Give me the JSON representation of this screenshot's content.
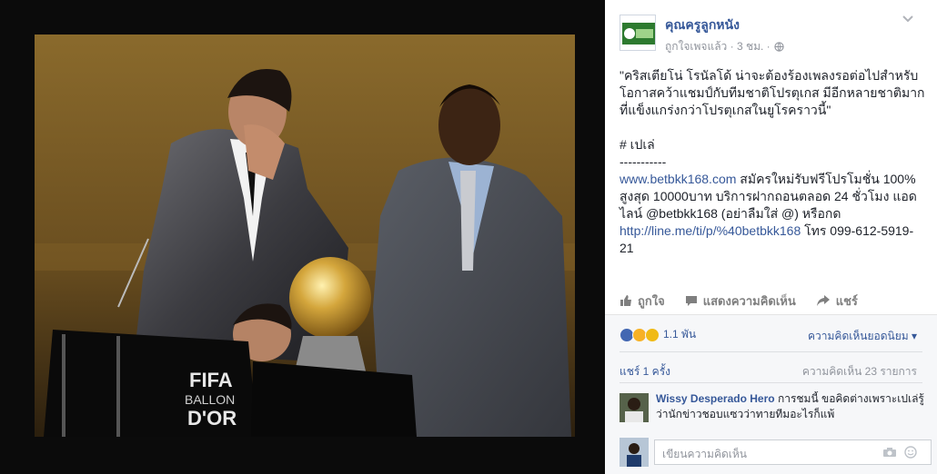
{
  "post": {
    "page_name": "คุณครูลูกหนัง",
    "subtitle": "ถูกใจเพจแล้ว · 3 ชม. ·",
    "caption": "\"คริสเตียโน่ โรนัลโด้ น่าจะต้องร้องเพลงรอต่อไปสำหรับโอกาสคว้าแชมป์กับทีมชาติโปรตุเกส มีอีกหลายชาติมากที่แข็งแกร่งกว่าโปรตุเกสในยูโรคราวนี้\"",
    "tag": "# เปเล่",
    "separator": "-----------",
    "promo_link": "www.betbkk168.com",
    "promo_text": " สมัครใหม่รับฟรีโปรโมชั่น 100% สูงสุด 10000บาท บริการฝากถอนตลอด 24 ชั่วโมง แอดไลน์ @betbkk168 (อย่าลืมใส่ @) หรือกด ",
    "line_link": "http://line.me/ti/p/%40betbkk168",
    "phone_text": " โทร 099-612-5919-21",
    "photo_text": {
      "fifa": "FIFA",
      "ballon": "BALLON",
      "dor": "D'OR"
    }
  },
  "actions": {
    "like": "ถูกใจ",
    "comment": "แสดงความคิดเห็น",
    "share": "แชร์"
  },
  "engagement": {
    "reactions_count": "1.1 พัน",
    "sort_label": "ความคิดเห็นยอดนิยม",
    "shares": "แชร์ 1 ครั้ง",
    "comments": "ความคิดเห็น 23 รายการ"
  },
  "comment": {
    "author": "Wissy Desperado Hero",
    "text": " การชมนี้ ขอคิดต่างเพราะเปเล่รู้ว่านักข่าวชอบแซวว่าทายทีมอะไรก็แพ้"
  },
  "composer": {
    "placeholder": "เขียนความคิดเห็น"
  },
  "colors": {
    "link": "#365899",
    "muted": "#90949c",
    "panel_footer": "#f6f7f9"
  }
}
